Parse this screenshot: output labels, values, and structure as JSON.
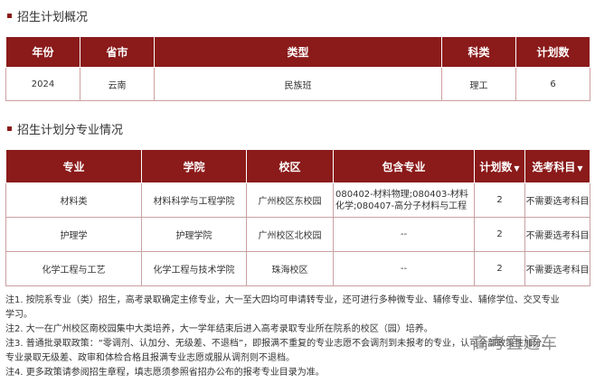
{
  "overview": {
    "title": "招生计划概况",
    "headers": [
      "年份",
      "省市",
      "类型",
      "科类",
      "计划数"
    ],
    "rows": [
      [
        "2024",
        "云南",
        "民族班",
        "理工",
        "6"
      ]
    ]
  },
  "majors": {
    "title": "招生计划分专业情况",
    "headers": [
      "专业",
      "学院",
      "校区",
      "包含专业",
      "计划数",
      "选考科目"
    ],
    "rows": [
      [
        "材料类",
        "材料科学与工程学院",
        "广州校区东校园",
        "080402-材料物理;080403-材料化学;080407-高分子材料与工程",
        "2",
        "不需要选考科目"
      ],
      [
        "护理学",
        "护理学院",
        "广州校区北校园",
        "--",
        "2",
        "不需要选考科目"
      ],
      [
        "化学工程与工艺",
        "化学工程与技术学院",
        "珠海校区",
        "--",
        "2",
        "不需要选考科目"
      ]
    ]
  },
  "notes": [
    "注1. 按院系专业（类）招生，高考录取确定主修专业，大一至大四均可申请转专业，还可进行多种微专业、辅修专业、辅修学位、交叉专业",
    "学习。",
    "注2. 大一在广州校区南校园集中大类培养，大一学年结束后进入高考录取专业所在院系的校区（园）培养。",
    "注3. 普通批录取政策：“零调剂、认加分、无级差、不退档”，即报满不重复的专业志愿不会调剂到未报考的专业，认可全部政策性加分、",
    "专业录取无级差、政审和体检合格且报满专业志愿或服从调剂则不退档。",
    "注4. 更多政策请参阅招生章程，填志愿须参照省招办公布的报考专业目录为准。"
  ],
  "watermark": "高考直通车",
  "colors": {
    "header_bg": "#8b1a1a",
    "border": "#8b1a1a"
  }
}
